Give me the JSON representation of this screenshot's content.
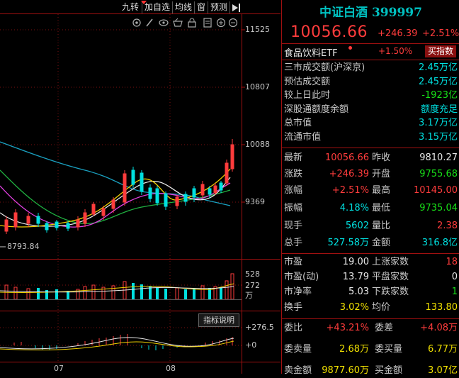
{
  "toolbar": {
    "items": [
      "九转",
      "加自选",
      "均线",
      "窗",
      "预测"
    ],
    "collapse_icon": "collapse-right-icon"
  },
  "chart_icons": [
    "settings-icon",
    "draw-icon",
    "eye-icon",
    "basket-icon",
    "lock-icon",
    "notes-icon",
    "zoom-in-icon",
    "zoom-out-icon"
  ],
  "price_axis": {
    "labels": [
      "11525",
      "10807",
      "10088",
      "9369"
    ],
    "low_marker": "8793.84"
  },
  "volume_axis": {
    "labels": [
      "528",
      "272",
      "万"
    ]
  },
  "indicator": {
    "button": "指标说明",
    "labels": [
      "+276.5",
      "+0"
    ]
  },
  "date_axis": {
    "labels": [
      "07",
      "08"
    ]
  },
  "colors": {
    "up": "#ff3c3c",
    "down": "#00e0e0",
    "frame": "#a01010",
    "title": "#00c0c0"
  },
  "quote": {
    "title": "中证白酒 399997",
    "price": "10056.66",
    "change": "+246.39",
    "pct": "+2.51%",
    "related_name": "食品饮料ETF",
    "related_pct": "+1.50%",
    "buy_button": "买指数"
  },
  "turnover_rows": [
    {
      "label": "三市成交额(沪深京)",
      "value": "2.45万亿"
    },
    {
      "label": "预估成交额",
      "value": "2.45万亿"
    },
    {
      "label": "较上日此时",
      "value": "-1923亿"
    },
    {
      "label": "深股通额度余额",
      "value": "额度充足"
    },
    {
      "label": "总市值",
      "value": "3.17万亿"
    },
    {
      "label": "流通市值",
      "value": "3.15万亿"
    }
  ],
  "stats": [
    {
      "l1": "最新",
      "v1": "10056.66",
      "l2": "昨收",
      "v2": "9810.27"
    },
    {
      "l1": "涨跌",
      "v1": "+246.39",
      "l2": "开盘",
      "v2": "9755.68"
    },
    {
      "l1": "涨幅",
      "v1": "+2.51%",
      "l2": "最高",
      "v2": "10145.00"
    },
    {
      "l1": "振幅",
      "v1": "4.18%",
      "l2": "最低",
      "v2": "9735.04"
    },
    {
      "l1": "现手",
      "v1": "5602",
      "l2": "量比",
      "v2": "2.38"
    },
    {
      "l1": "总手",
      "v1": "527.58万",
      "l2": "金额",
      "v2": "316.8亿"
    },
    {
      "l1": "市盈",
      "v1": "19.00",
      "l2": "上涨家数",
      "v2": "18"
    },
    {
      "l1": "市盈(动)",
      "v1": "13.79",
      "l2": "平盘家数",
      "v2": "0"
    },
    {
      "l1": "市净率",
      "v1": "5.03",
      "l2": "下跌家数",
      "v2": "1"
    },
    {
      "l1": "换手",
      "v1": "3.02%",
      "l2": "均价",
      "v2": "133.80"
    }
  ],
  "orders": [
    {
      "l1": "委比",
      "v1": "+43.21%",
      "l2": "委差",
      "v2": "+4.08万"
    },
    {
      "l1": "委卖量",
      "v1": "2.68万",
      "l2": "委买量",
      "v2": "6.77万"
    },
    {
      "l1": "卖金额",
      "v1": "9877.60万",
      "l2": "买金额",
      "v2": "3.07亿"
    }
  ]
}
